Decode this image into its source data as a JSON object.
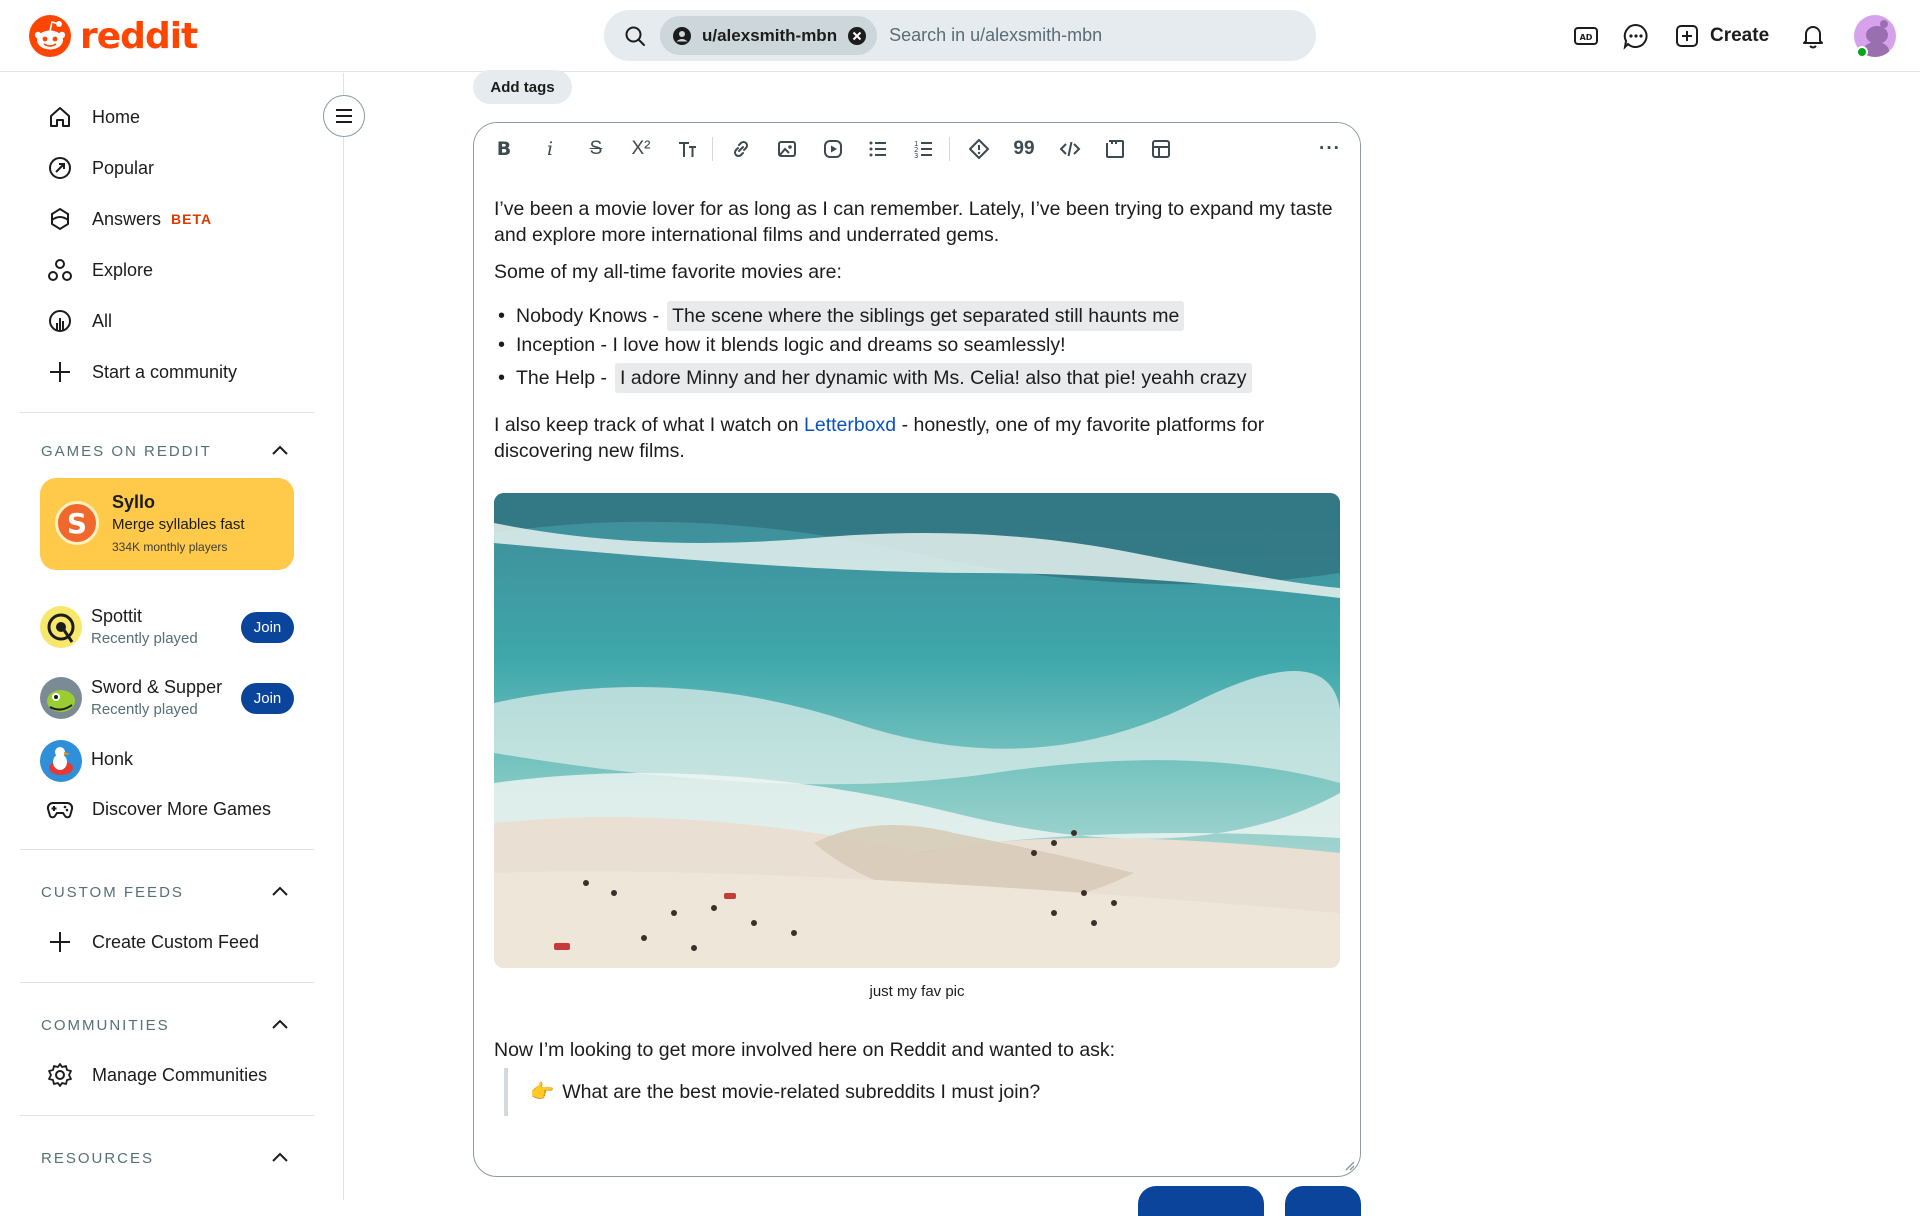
{
  "header": {
    "logo_text": "reddit",
    "search_chip": "u/alexsmith-mbn",
    "search_placeholder": "Search in u/alexsmith-mbn",
    "create_label": "Create"
  },
  "sidebar": {
    "nav": [
      {
        "label": "Home",
        "icon": "home-icon"
      },
      {
        "label": "Popular",
        "icon": "popular-icon"
      },
      {
        "label": "Answers",
        "icon": "answers-icon",
        "badge": "BETA"
      },
      {
        "label": "Explore",
        "icon": "explore-icon"
      },
      {
        "label": "All",
        "icon": "all-icon"
      },
      {
        "label": "Start a community",
        "icon": "plus-icon"
      }
    ],
    "games_title": "GAMES ON REDDIT",
    "featured_game": {
      "title": "Syllo",
      "subtitle": "Merge syllables fast",
      "players": "334K monthly players"
    },
    "games": [
      {
        "name": "Spottit",
        "sub": "Recently played",
        "join": "Join"
      },
      {
        "name": "Sword & Supper",
        "sub": "Recently played",
        "join": "Join"
      },
      {
        "name": "Honk",
        "sub": ""
      }
    ],
    "discover_label": "Discover More Games",
    "custom_feeds_title": "CUSTOM FEEDS",
    "create_feed_label": "Create Custom Feed",
    "communities_title": "COMMUNITIES",
    "manage_label": "Manage Communities",
    "resources_title": "RESOURCES"
  },
  "main": {
    "add_tags": "Add tags",
    "para1": "I’ve been a movie lover for as long as I can remember. Lately, I’ve been trying to expand my taste and explore more international films and underrated gems.",
    "para2": "Some of my all-time favorite movies are:",
    "bullets": [
      {
        "title": "Nobody Knows -",
        "note": "The scene where the siblings get separated still haunts me",
        "highlight": true
      },
      {
        "title": "Inception - I love how it blends logic and dreams so seamlessly!",
        "note": "",
        "highlight": false
      },
      {
        "title": "The Help -",
        "note": "I adore Minny and her dynamic with Ms. Celia! also that pie! yeahh crazy",
        "highlight": true
      }
    ],
    "para3_before": "I also keep track of what I watch on ",
    "para3_link": "Letterboxd",
    "para3_after": " - honestly, one of my favorite platforms for discovering new films.",
    "image_caption": "just my fav pic",
    "para4": "Now I’m looking to get more involved here on Reddit and wanted to ask:",
    "quote_emoji": "👉",
    "quote_text": "What are the best movie-related subreddits I must join?"
  },
  "colors": {
    "brand": "#ff4500",
    "join_button": "#0a449b",
    "syllo_card": "#ffc94a",
    "link": "#0a53be"
  }
}
